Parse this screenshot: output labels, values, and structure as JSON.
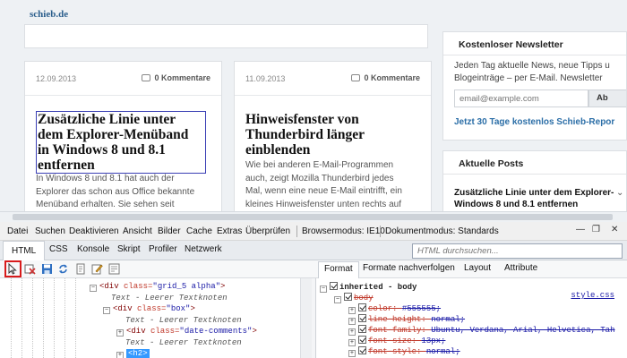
{
  "site": {
    "name": "schieb.de"
  },
  "articles": [
    {
      "date": "12.09.2013",
      "comments": "0 Kommentare",
      "title_lines": [
        "Zusätzliche Linie unter",
        "dem Explorer-Menüband",
        "in Windows 8 und 8.1",
        "entfernen"
      ],
      "excerpt_lines": [
        "In Windows 8 und 8.1 hat auch der",
        "Explorer das schon aus Office bekannte",
        "Menüband erhalten. Sie sehen seit"
      ]
    },
    {
      "date": "11.09.2013",
      "comments": "0 Kommentare",
      "title_lines": [
        "Hinweisfenster von",
        "Thunderbird länger",
        "einblenden"
      ],
      "excerpt_lines": [
        "Wie bei anderen E-Mail-Programmen",
        "auch, zeigt Mozilla Thunderbird jedes",
        "Mal, wenn eine neue E-Mail eintrifft, ein",
        "kleines Hinweisfenster unten rechts auf"
      ]
    }
  ],
  "sidebar": {
    "newsletter": {
      "heading": "Kostenloser Newsletter",
      "text_lines": [
        "Jeden Tag aktuelle News, neue Tipps u",
        "Blogeinträge – per E-Mail. Newsletter"
      ],
      "email_placeholder": "email@example.com",
      "button_label": "Ab",
      "trial_link": "Jetzt 30 Tage kostenlos Schieb-Repor"
    },
    "recent": {
      "heading": "Aktuelle Posts",
      "post_lines": [
        "Zusätzliche Linie unter dem Explorer-",
        "Windows 8 und 8.1 entfernen"
      ]
    }
  },
  "devtools": {
    "menu": {
      "items": [
        "Datei",
        "Suchen",
        "Deaktivieren",
        "Ansicht",
        "Bilder",
        "Cache",
        "Extras",
        "Überprüfen"
      ],
      "browser_mode": "Browsermodus: IE10",
      "document_mode": "Dokumentmodus: Standards"
    },
    "tabs": [
      "HTML",
      "CSS",
      "Konsole",
      "Skript",
      "Profiler",
      "Netzwerk"
    ],
    "active_tab": "HTML",
    "search_placeholder": "HTML durchsuchen...",
    "right_tabs": [
      "Format",
      "Formate nachverfolgen",
      "Layout",
      "Attribute"
    ],
    "dom_lines": [
      {
        "tag_open": "<div",
        "attr": " class=",
        "val": "\"grid_5 alpha\"",
        "tag_close": ">"
      },
      {
        "comment": "Text - Leerer Textknoten"
      },
      {
        "tag_open": "<div",
        "attr": " class=",
        "val": "\"box\"",
        "tag_close": ">"
      },
      {
        "comment": "Text - Leerer Textknoten"
      },
      {
        "tag_open": "<div",
        "attr": " class=",
        "val": "\"date-comments\"",
        "tag_close": ">"
      },
      {
        "comment": "Text - Leerer Textknoten"
      },
      {
        "selected": "<h2>"
      }
    ],
    "styles": {
      "inherited_label": "inherited - body",
      "selector": "body",
      "source_link": "style.css",
      "props": [
        {
          "name": "color",
          "value": "#555555;"
        },
        {
          "name": "line-height",
          "value": "normal;"
        },
        {
          "name": "font-family",
          "value": "Ubuntu, Verdana, Arial, Helvetica, Tah"
        },
        {
          "name": "font-size",
          "value": "13px;"
        },
        {
          "name": "font-style",
          "value": "normal;"
        }
      ]
    }
  },
  "colors": {
    "accent_link": "#2b6ea7",
    "selection": "#3399ff",
    "highlight_box": "#d81b1b"
  }
}
